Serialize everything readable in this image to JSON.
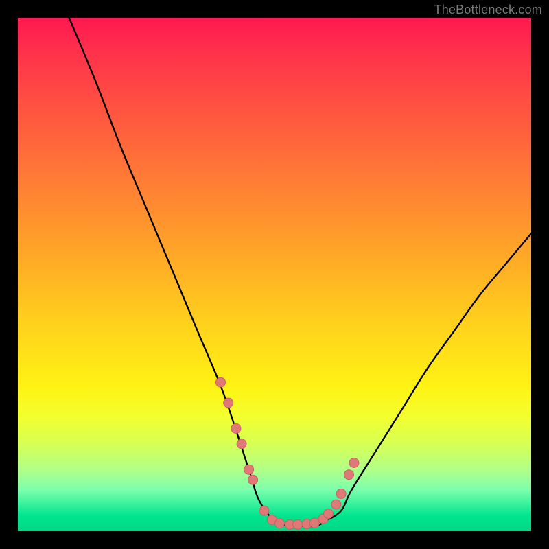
{
  "watermark": "TheBottleneck.com",
  "colors": {
    "gradient_top": "#ff1850",
    "gradient_mid": "#ffd21c",
    "gradient_bottom": "#00d886",
    "curve": "#000000",
    "marker_fill": "#e07878",
    "marker_stroke": "#c96262",
    "frame": "#000000"
  },
  "chart_data": {
    "type": "line",
    "title": "",
    "xlabel": "",
    "ylabel": "",
    "xlim": [
      0,
      100
    ],
    "ylim": [
      0,
      100
    ],
    "grid": false,
    "legend": false,
    "series": [
      {
        "name": "bottleneck-curve",
        "x": [
          10,
          15,
          20,
          25,
          30,
          35,
          40,
          45,
          47,
          50,
          53,
          55,
          58,
          60,
          63,
          65,
          70,
          75,
          80,
          85,
          90,
          95,
          100
        ],
        "y": [
          100,
          88,
          75,
          63,
          51,
          39,
          27,
          12,
          6,
          2,
          1,
          1,
          1,
          2,
          4,
          8,
          16,
          24,
          32,
          39,
          46,
          52,
          58
        ]
      }
    ],
    "markers": {
      "name": "highlight-points",
      "x": [
        39.5,
        41,
        42.5,
        43.6,
        45,
        45.8,
        48,
        49.5,
        51,
        53,
        54.5,
        56.3,
        57.8,
        59.5,
        60.5,
        62,
        63,
        64.5,
        65.5
      ],
      "y": [
        29,
        25,
        20,
        17,
        12,
        10,
        4,
        2.2,
        1.5,
        1.3,
        1.3,
        1.4,
        1.6,
        2.4,
        3.4,
        5.2,
        7.3,
        11,
        13.3
      ]
    }
  }
}
